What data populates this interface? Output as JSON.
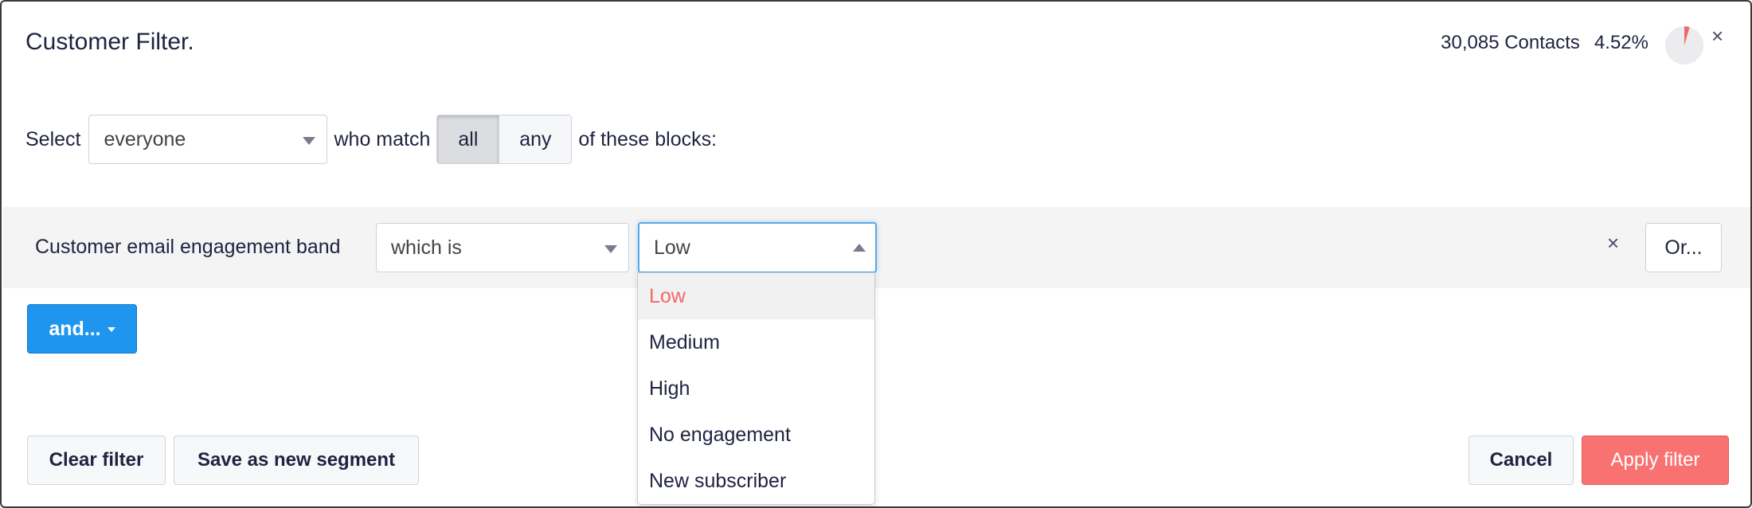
{
  "header": {
    "title": "Customer Filter.",
    "contacts": "30,085 Contacts",
    "percentage": "4.52%",
    "pie_fraction": 0.0452,
    "pie_color": "#f26868",
    "close_icon": "×"
  },
  "select_row": {
    "prefix": "Select",
    "audience": "everyone",
    "middle": "who match",
    "match_options": [
      "all",
      "any"
    ],
    "match_selected": "all",
    "suffix": "of these blocks:"
  },
  "block": {
    "field": "Customer email engagement band",
    "operator": "which is",
    "value": "Low",
    "remove_icon": "×",
    "or_label": "Or..."
  },
  "dropdown": {
    "options": [
      "Low",
      "Medium",
      "High",
      "No engagement",
      "New subscriber"
    ],
    "selected": "Low"
  },
  "and_button": {
    "label": "and..."
  },
  "footer": {
    "clear": "Clear filter",
    "save": "Save as new segment",
    "cancel": "Cancel",
    "apply": "Apply filter"
  },
  "colors": {
    "primary_blue": "#1e96f0",
    "apply_red": "#f87272",
    "accent_red": "#f26868"
  }
}
